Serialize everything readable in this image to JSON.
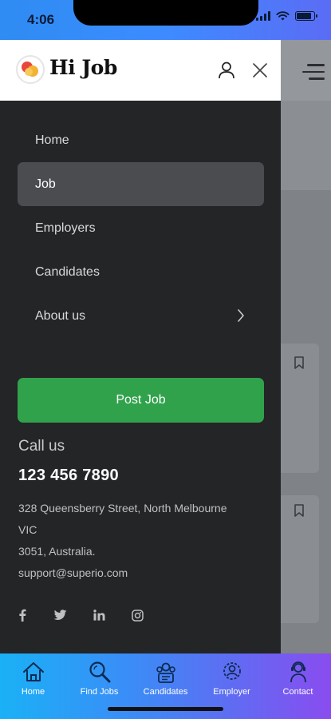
{
  "status": {
    "time": "4:06",
    "battery_level": 0.85
  },
  "header": {
    "brand": "Hi Job"
  },
  "menu": {
    "items": [
      {
        "label": "Home"
      },
      {
        "label": "Job"
      },
      {
        "label": "Employers"
      },
      {
        "label": "Candidates"
      },
      {
        "label": "About us"
      }
    ],
    "active": "Job"
  },
  "post_button": {
    "label": "Post Job"
  },
  "contact": {
    "call_label": "Call us",
    "phone": "123 456 7890",
    "address_line1": "328 Queensberry Street, North Melbourne",
    "address_line2": "VIC",
    "address_line3": "3051, Australia.",
    "email": "support@superio.com"
  },
  "social_icons": [
    "facebook-icon",
    "twitter-icon",
    "linkedin-icon",
    "instagram-icon"
  ],
  "tabs": [
    {
      "label": "Home",
      "icon": "home-icon"
    },
    {
      "label": "Find Jobs",
      "icon": "search-icon"
    },
    {
      "label": "Candidates",
      "icon": "candidates-icon"
    },
    {
      "label": "Employer",
      "icon": "employer-icon"
    },
    {
      "label": "Contact",
      "icon": "contact-icon"
    }
  ],
  "colors": {
    "accent_green": "#31a24c",
    "drawer_bg": "#232527",
    "active_item_bg": "#4a4c50",
    "tabbar_gradient_start": "#1ab1f6",
    "tabbar_gradient_end": "#8a4cf0"
  }
}
